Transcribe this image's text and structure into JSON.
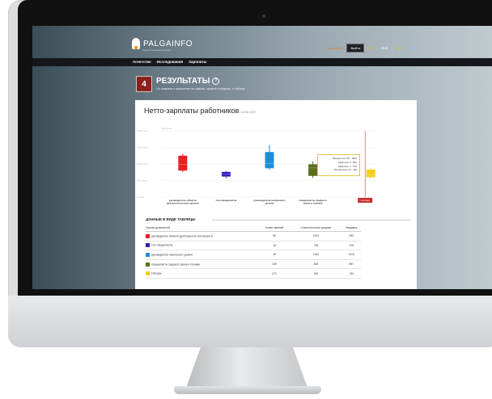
{
  "header": {
    "logo_text": "PALGAINFO",
    "logo_sub": "Payroll Integrated Analysis",
    "user_name": "Ivan Ivanov",
    "logout_label": "Выйти",
    "languages": [
      "EST",
      "RUS",
      "ENG"
    ],
    "active_language": "RUS"
  },
  "nav": {
    "items": [
      "Агентство",
      "Исследования",
      "Зарплаты"
    ]
  },
  "results": {
    "step_number": "4",
    "title": "РЕЗУЛЬТАТЫ",
    "subtitle": "См. медианы и процентили на графике, среднее и медиану - в таблице."
  },
  "panel": {
    "title": "Нетто-зарплаты работников",
    "season": "Осень 2017"
  },
  "chart_data": {
    "type": "boxplot",
    "ylabel": "Значения",
    "ylim": [
      0,
      2000
    ],
    "yticks": [
      0,
      500,
      1000,
      1500,
      2000
    ],
    "y_tick_labels": [
      "0 евро",
      "500 евро",
      "1000 евро",
      "1500 евро",
      "2000 евро"
    ],
    "grid": true,
    "categories": [
      "руководитель области деятельности или проекта",
      "топ-специалисты",
      "руководители начального уровня",
      "специалисты среднего звена и техники",
      "слесарь"
    ],
    "colors": [
      "#e8201e",
      "#3a1fb8",
      "#1e8fd6",
      "#5a6f1a",
      "#f5cd1a"
    ],
    "series": [
      {
        "low": 750,
        "q1": 800,
        "median": 990,
        "q3": 1250,
        "high": 1310
      },
      {
        "low": 570,
        "q1": 620,
        "median": 700,
        "q3": 760,
        "high": 790
      },
      {
        "low": 820,
        "q1": 870,
        "median": 1020,
        "q3": 1360,
        "high": 1570
      },
      {
        "low": 580,
        "q1": 640,
        "median": 880,
        "q3": 990,
        "high": 1080
      },
      {
        "low": 560,
        "q1": 600,
        "median": 680,
        "q3": 830,
        "high": 870
      }
    ],
    "highlight_label": "слесарь",
    "tooltip": {
      "lines": [
        "Процентиль 90 : 1002",
        "Квартиль 3 : 891",
        "Квартиль 1 : 575",
        "Процентиль 10 : 490"
      ]
    }
  },
  "table": {
    "title": "ДАННЫЕ В ВИДЕ ТАБЛИЦЫ",
    "headers": [
      "Группы должностей",
      "Колво записей",
      "Статистическое среднее",
      "Медиана"
    ],
    "rows": [
      {
        "name": "руководитель области деятельности или проекта",
        "count": "66",
        "mean": "1003",
        "median": "992",
        "color": "#e8201e"
      },
      {
        "name": "топ-специалисты",
        "count": "18",
        "mean": "738",
        "median": "705",
        "color": "#3a1fb8"
      },
      {
        "name": "руководители начального уровня",
        "count": "15",
        "mean": "1182",
        "median": "1116",
        "color": "#1e8fd6"
      },
      {
        "name": "специалисты среднего звена и техники",
        "count": "249",
        "mean": "828",
        "median": "897",
        "color": "#5a6f1a"
      },
      {
        "name": "слесарь",
        "count": "271",
        "mean": "765",
        "median": "730",
        "color": "#f5cd1a"
      }
    ]
  }
}
